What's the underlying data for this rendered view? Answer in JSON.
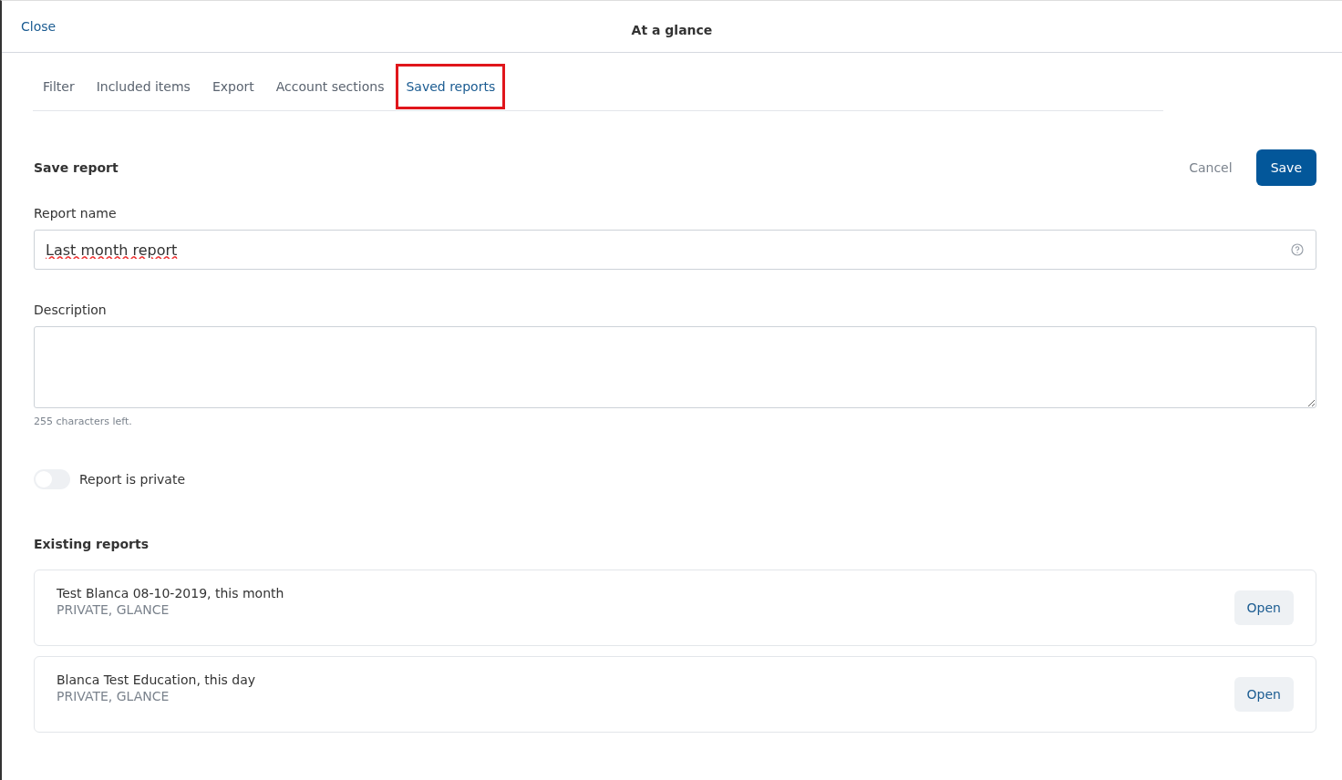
{
  "header": {
    "close": "Close",
    "title": "At a glance"
  },
  "tabs": [
    {
      "label": "Filter",
      "selected": false,
      "highlighted": false
    },
    {
      "label": "Included items",
      "selected": false,
      "highlighted": false
    },
    {
      "label": "Export",
      "selected": false,
      "highlighted": false
    },
    {
      "label": "Account sections",
      "selected": false,
      "highlighted": false
    },
    {
      "label": "Saved reports",
      "selected": true,
      "highlighted": true
    }
  ],
  "save_report": {
    "heading": "Save report",
    "cancel": "Cancel",
    "save": "Save",
    "name_label": "Report name",
    "name_value": "Last month report",
    "description_label": "Description",
    "counter": "255 characters left.",
    "private_toggle": {
      "label": "Report is private",
      "on": false
    }
  },
  "existing": {
    "heading": "Existing reports",
    "reports": [
      {
        "name": "Test Blanca 08-10-2019, this month",
        "tags": "PRIVATE, GLANCE",
        "action": "Open"
      },
      {
        "name": "Blanca Test Education, this day",
        "tags": "PRIVATE, GLANCE",
        "action": "Open"
      }
    ]
  }
}
